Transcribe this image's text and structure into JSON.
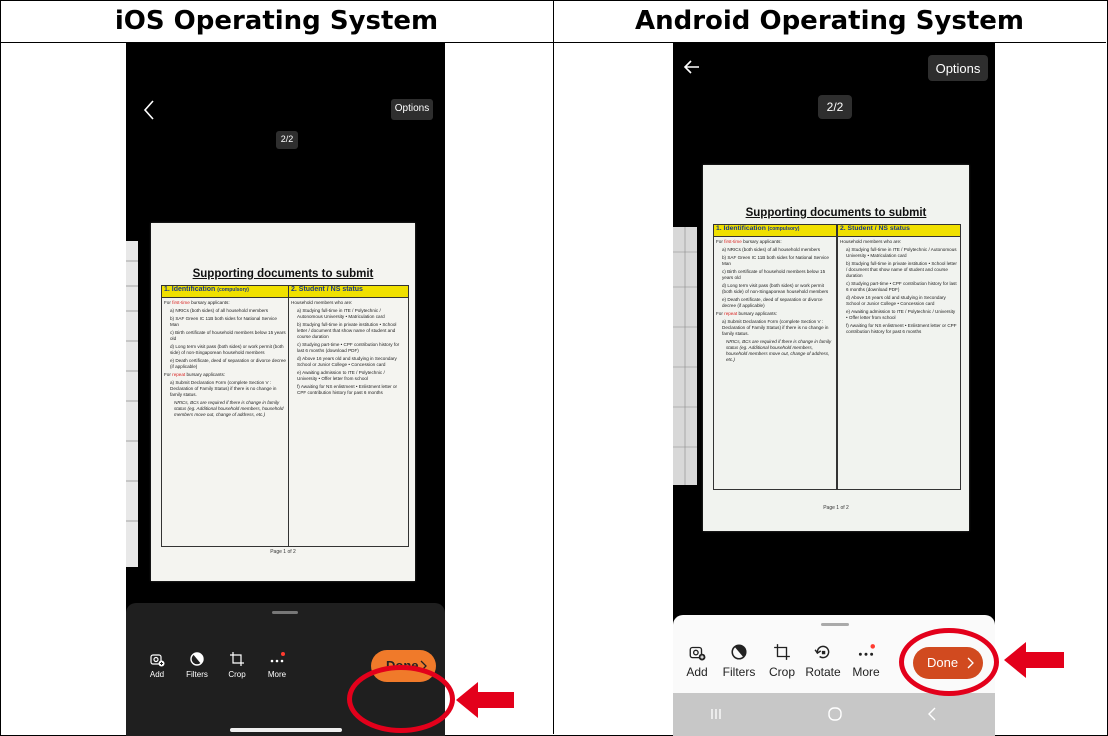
{
  "table": {
    "ios_header": "iOS Operating System",
    "android_header": "Android Operating System"
  },
  "ios": {
    "options_label": "Options",
    "page_counter": "2/2",
    "done_label": "Done",
    "toolbar": [
      {
        "label": "Add",
        "icon": "add-photo-icon"
      },
      {
        "label": "Filters",
        "icon": "filters-icon"
      },
      {
        "label": "Crop",
        "icon": "crop-icon"
      },
      {
        "label": "More",
        "icon": "more-icon"
      }
    ]
  },
  "android": {
    "options_label": "Options",
    "page_counter": "2/2",
    "done_label": "Done",
    "toolbar": [
      {
        "label": "Add",
        "icon": "add-photo-icon"
      },
      {
        "label": "Filters",
        "icon": "filters-icon"
      },
      {
        "label": "Crop",
        "icon": "crop-icon"
      },
      {
        "label": "Rotate",
        "icon": "rotate-icon"
      },
      {
        "label": "More",
        "icon": "more-icon"
      }
    ],
    "navbar": [
      "recents-icon",
      "home-icon",
      "back-icon"
    ]
  },
  "document": {
    "title": "Supporting documents to submit",
    "col1_header": "1. Identification",
    "col1_header_note": "(compulsory)",
    "col2_header": "2. Student / NS status",
    "first_time_prefix": "For",
    "first_time_red": "first-time",
    "first_time_suffix": "bursary applicants:",
    "col1_items": [
      "a) NRICs (both sides) of all household members",
      "b) SAF Green IC 11B both sides for National Service Man",
      "c) Birth certificate of household members below 15 years old",
      "d) Long term visit pass (both sides) or work permit (both side) of non-Singaporean household members",
      "e) Death certificate, deed of separation or divorce decree (if applicable)"
    ],
    "repeat_prefix": "For",
    "repeat_red": "repeat",
    "repeat_suffix": "bursary applicants:",
    "repeat_item": "a) Submit Declaration Form (complete Section V : Declaration of Family Status) if there is no change in family status.",
    "repeat_note": "NRICs, BCs are required if there is change in family status (eg. Additional household members, household members move out, change of address, etc.)",
    "col2_intro": "Household members who are:",
    "col2_items": [
      "a) Studying full-time in ITE / Polytechnic / Autonomous University • Matriculation card",
      "b) Studying full-time in private institution • School letter / document that show name of student and course duration",
      "c) Studying part-time • CPF contribution history for last 6 months (download PDF)",
      "d) Above 16 years old and studying in Secondary School or Junior College • Concession card",
      "e) Awaiting admission to ITE / Polytechnic / University • Offer letter from school",
      "f) Awaiting for NS enlistment • Enlistment letter or CPF contribution history for past 6 months"
    ],
    "page_label": "Page 1 of 2"
  },
  "colors": {
    "ios_done": "#f07a2a",
    "android_done": "#d14a1f",
    "highlight_red": "#e3001b",
    "header_yellow": "#f0e000"
  }
}
